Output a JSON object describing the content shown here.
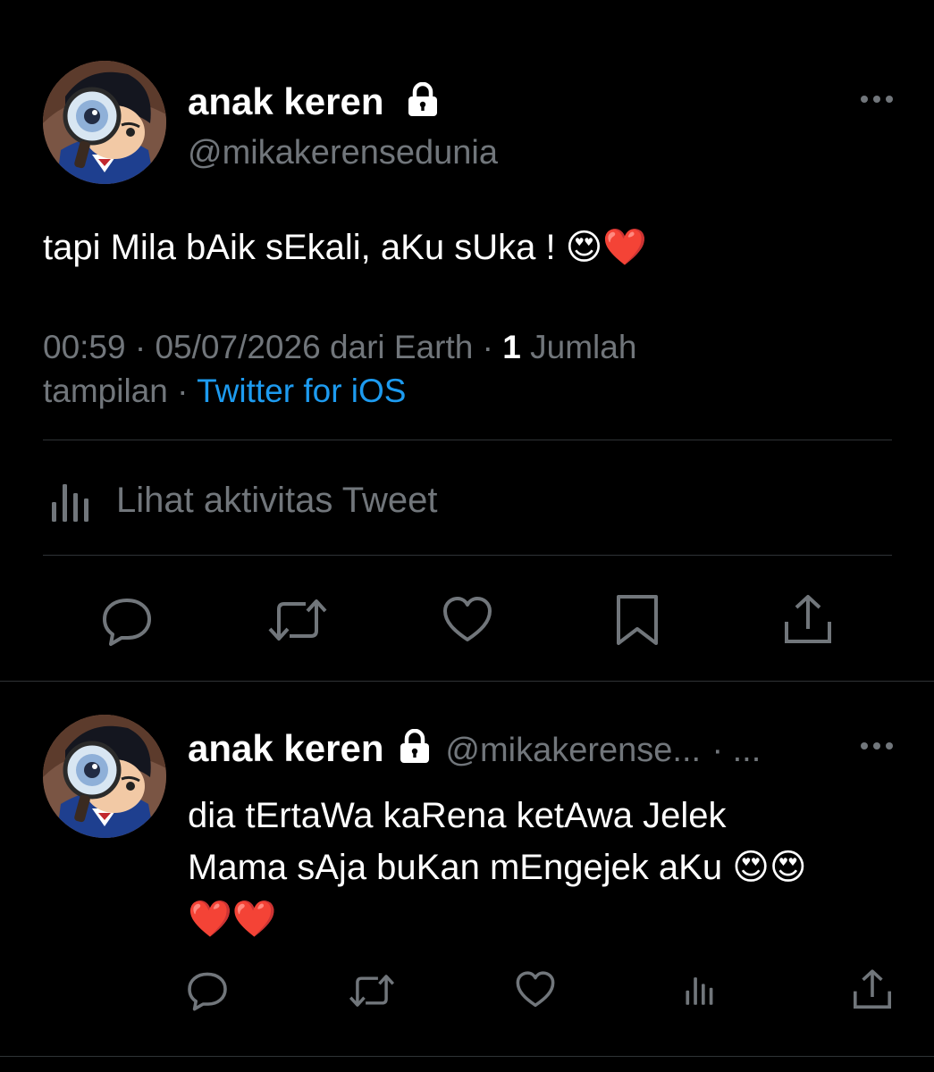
{
  "main_tweet": {
    "author": {
      "name": "anak keren",
      "handle": "@mikakerensedunia",
      "avatar": "avatar-detective-icon",
      "protected_icon": "lock-icon"
    },
    "more_icon": "more-horizontal-icon",
    "text": "tapi Mila bAik sEkali, aKu sUka ! 😍❤️",
    "meta": {
      "time": "00:59",
      "date": "05/07/2026",
      "location_text": "dari Earth",
      "separator": "·",
      "views_count": "1",
      "views_label_1": "Jumlah",
      "views_label_2": "tampilan",
      "source": "Twitter for iOS"
    },
    "activity": {
      "icon": "analytics-icon",
      "label": "Lihat aktivitas Tweet"
    },
    "actions": [
      {
        "name": "reply",
        "icon": "reply-icon"
      },
      {
        "name": "retweet",
        "icon": "retweet-icon"
      },
      {
        "name": "like",
        "icon": "heart-icon"
      },
      {
        "name": "bookmark",
        "icon": "bookmark-icon"
      },
      {
        "name": "share",
        "icon": "share-icon"
      }
    ]
  },
  "reply_tweet": {
    "author": {
      "name": "anak keren",
      "handle": "@mikakerense...",
      "separator": "·",
      "time": "...",
      "avatar": "avatar-detective-icon",
      "protected_icon": "lock-icon"
    },
    "more_icon": "more-horizontal-icon",
    "text_line1": "dia tErtaWa kaRena ketAwa Jelek",
    "text_line2": "Mama sAja buKan mEngejek aKu 😍😍",
    "text_line3": "❤️❤️",
    "actions": [
      {
        "name": "reply",
        "icon": "reply-icon"
      },
      {
        "name": "retweet",
        "icon": "retweet-icon"
      },
      {
        "name": "like",
        "icon": "heart-icon"
      },
      {
        "name": "analytics",
        "icon": "analytics-icon"
      },
      {
        "name": "share",
        "icon": "share-icon"
      }
    ]
  },
  "colors": {
    "background": "#000000",
    "primary_text": "#ffffff",
    "secondary_text": "#71767b",
    "link": "#1d9bf0",
    "divider": "#2f3336"
  }
}
